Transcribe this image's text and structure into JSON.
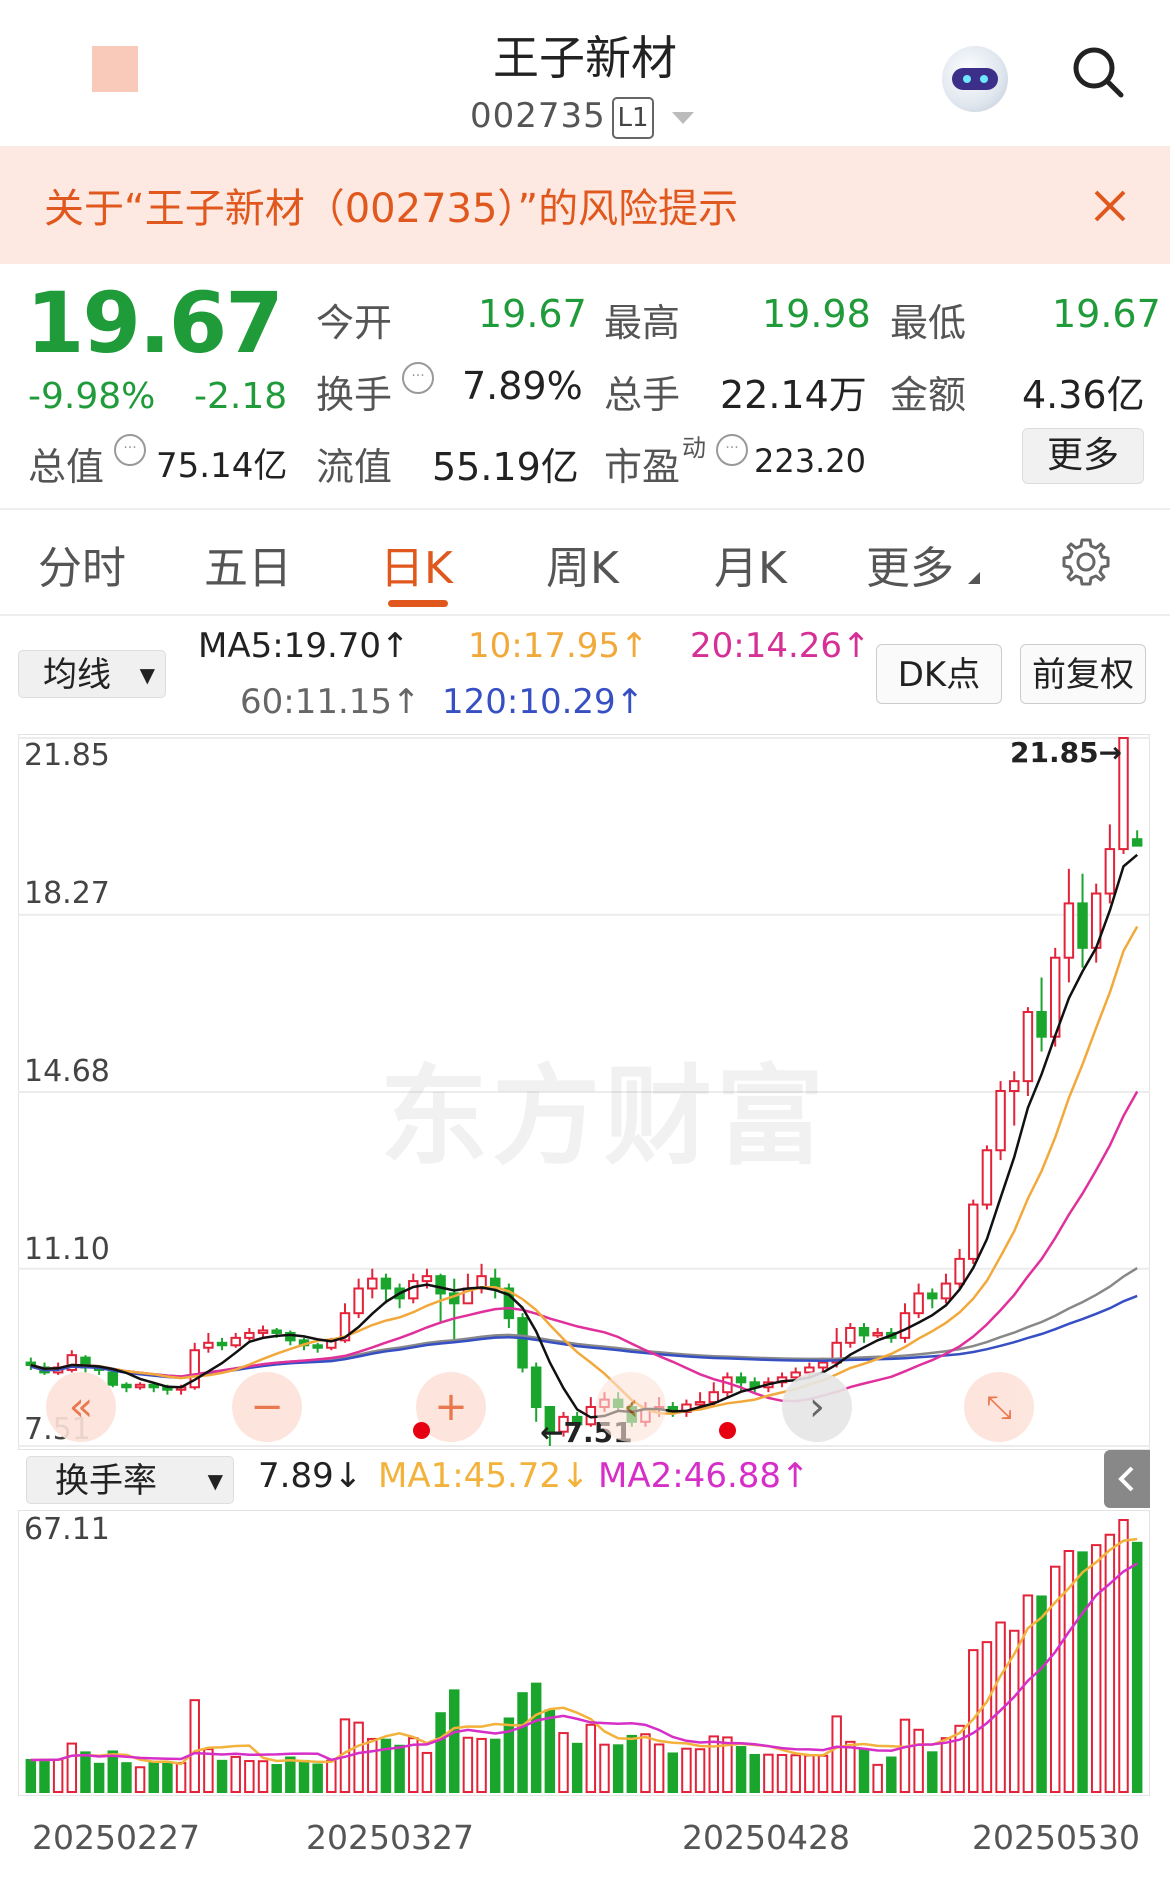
{
  "header": {
    "title": "王子新材",
    "code": "002735",
    "level_badge": "L1"
  },
  "banner": {
    "text": "关于“王子新材（002735）”的风险提示"
  },
  "quote": {
    "price": "19.67",
    "change_pct": "-9.98%",
    "change_amt": "-2.18",
    "fields": {
      "open_label": "今开",
      "open": "19.67",
      "high_label": "最高",
      "high": "19.98",
      "low_label": "最低",
      "low": "19.67",
      "turnover_label": "换手",
      "turnover": "7.89%",
      "volume_label": "总手",
      "volume": "22.14万",
      "amount_label": "金额",
      "amount": "4.36亿",
      "mcap_label": "总值",
      "mcap": "75.14亿",
      "float_label": "流值",
      "float": "55.19亿",
      "pe_label": "市盈",
      "pe_sup": "动",
      "pe": "223.20"
    },
    "more_label": "更多"
  },
  "tabs": [
    "分时",
    "五日",
    "日K",
    "周K",
    "月K",
    "更多"
  ],
  "active_tab": "日K",
  "indicators": {
    "ma_select": "均线",
    "ma5": "MA5:19.70↑",
    "ma10": "10:17.95↑",
    "ma20": "20:14.26↑",
    "ma60": "60:11.15↑",
    "ma120": "120:10.29↑",
    "dk_label": "DK点",
    "adjust_label": "前复权"
  },
  "kline": {
    "y_labels": [
      "21.85",
      "18.27",
      "14.68",
      "11.10",
      "7.51"
    ],
    "max_label": "21.85→",
    "min_label": "←7.51",
    "watermark": "东方财富",
    "colors": {
      "up": "#e2233a",
      "down": "#1aa52d",
      "ma5": "#111111",
      "ma10": "#f2a93b",
      "ma20": "#e0309c",
      "ma60": "#888888",
      "ma120": "#3650c4"
    }
  },
  "volume": {
    "select_label": "换手率",
    "value": "7.89↓",
    "ma1": "MA1:45.72↓",
    "ma2": "MA2:46.88↑",
    "y_label": "67.11"
  },
  "dates": [
    "20250227",
    "20250327",
    "20250428",
    "20250530"
  ],
  "chart_data": {
    "type": "candlestick",
    "ylim": [
      7.51,
      21.85
    ],
    "max": 21.85,
    "min": 7.51,
    "candles": [
      [
        9.2,
        9.15,
        9.3,
        9.05
      ],
      [
        9.1,
        9.0,
        9.2,
        8.95
      ],
      [
        9.0,
        9.1,
        9.2,
        8.95
      ],
      [
        9.05,
        9.35,
        9.45,
        9.0
      ],
      [
        9.3,
        9.1,
        9.35,
        9.0
      ],
      [
        9.1,
        9.05,
        9.15,
        8.95
      ],
      [
        9.0,
        8.75,
        9.05,
        8.7
      ],
      [
        8.75,
        8.7,
        8.8,
        8.6
      ],
      [
        8.7,
        8.75,
        8.8,
        8.65
      ],
      [
        8.75,
        8.7,
        8.8,
        8.6
      ],
      [
        8.7,
        8.65,
        8.75,
        8.55
      ],
      [
        8.65,
        8.7,
        8.75,
        8.55
      ],
      [
        8.7,
        9.45,
        9.6,
        8.65
      ],
      [
        9.5,
        9.6,
        9.8,
        9.4
      ],
      [
        9.6,
        9.55,
        9.7,
        9.45
      ],
      [
        9.55,
        9.7,
        9.8,
        9.5
      ],
      [
        9.7,
        9.8,
        9.9,
        9.65
      ],
      [
        9.8,
        9.85,
        9.95,
        9.7
      ],
      [
        9.85,
        9.8,
        9.9,
        9.7
      ],
      [
        9.8,
        9.65,
        9.85,
        9.55
      ],
      [
        9.65,
        9.55,
        9.7,
        9.45
      ],
      [
        9.55,
        9.5,
        9.6,
        9.4
      ],
      [
        9.5,
        9.65,
        9.7,
        9.45
      ],
      [
        9.65,
        10.2,
        10.4,
        9.6
      ],
      [
        10.2,
        10.7,
        10.9,
        10.1
      ],
      [
        10.7,
        10.9,
        11.1,
        10.5
      ],
      [
        10.9,
        10.7,
        11.0,
        10.4
      ],
      [
        10.7,
        10.5,
        10.8,
        10.3
      ],
      [
        10.5,
        10.85,
        11.0,
        10.4
      ],
      [
        10.85,
        10.95,
        11.1,
        10.7
      ],
      [
        10.95,
        10.6,
        11.0,
        10.0
      ],
      [
        10.6,
        10.4,
        10.9,
        9.6
      ],
      [
        10.4,
        10.7,
        11.0,
        10.4
      ],
      [
        10.7,
        10.95,
        11.2,
        10.6
      ],
      [
        10.9,
        10.7,
        11.1,
        10.5
      ],
      [
        10.7,
        10.1,
        10.8,
        9.9
      ],
      [
        10.1,
        9.1,
        10.2,
        9.0
      ],
      [
        9.1,
        8.3,
        9.2,
        8.0
      ],
      [
        8.3,
        7.8,
        8.3,
        7.51
      ],
      [
        7.8,
        8.1,
        8.2,
        7.7
      ],
      [
        8.1,
        7.95,
        8.2,
        7.8
      ],
      [
        7.95,
        8.3,
        8.5,
        7.9
      ],
      [
        8.3,
        8.45,
        8.6,
        8.2
      ],
      [
        8.45,
        8.3,
        8.6,
        8.2
      ],
      [
        8.3,
        8.0,
        8.4,
        7.9
      ],
      [
        8.0,
        8.25,
        8.4,
        7.9
      ],
      [
        8.25,
        8.3,
        8.5,
        8.1
      ],
      [
        8.3,
        8.2,
        8.4,
        8.1
      ],
      [
        8.2,
        8.35,
        8.45,
        8.1
      ],
      [
        8.35,
        8.4,
        8.6,
        8.25
      ],
      [
        8.4,
        8.6,
        8.8,
        8.3
      ],
      [
        8.6,
        8.9,
        9.0,
        8.5
      ],
      [
        8.9,
        8.8,
        9.0,
        8.6
      ],
      [
        8.8,
        8.7,
        8.9,
        8.6
      ],
      [
        8.7,
        8.8,
        8.9,
        8.6
      ],
      [
        8.8,
        8.9,
        9.0,
        8.7
      ],
      [
        8.9,
        9.0,
        9.1,
        8.8
      ],
      [
        9.0,
        9.1,
        9.2,
        8.9
      ],
      [
        9.1,
        9.2,
        9.3,
        9.0
      ],
      [
        9.2,
        9.6,
        9.9,
        9.1
      ],
      [
        9.6,
        9.9,
        10.0,
        9.5
      ],
      [
        9.9,
        9.75,
        10.0,
        9.6
      ],
      [
        9.75,
        9.8,
        9.9,
        9.7
      ],
      [
        9.8,
        9.7,
        9.9,
        9.6
      ],
      [
        9.7,
        10.2,
        10.4,
        9.6
      ],
      [
        10.2,
        10.6,
        10.8,
        10.1
      ],
      [
        10.6,
        10.5,
        10.7,
        10.3
      ],
      [
        10.5,
        10.8,
        11.0,
        10.4
      ],
      [
        10.8,
        11.3,
        11.5,
        10.7
      ],
      [
        11.3,
        12.4,
        12.5,
        11.2
      ],
      [
        12.4,
        13.5,
        13.6,
        12.3
      ],
      [
        13.5,
        14.7,
        14.9,
        13.3
      ],
      [
        14.7,
        14.9,
        15.1,
        14.0
      ],
      [
        14.9,
        16.3,
        16.4,
        14.6
      ],
      [
        16.3,
        15.8,
        17.0,
        15.5
      ],
      [
        15.8,
        17.4,
        17.6,
        15.6
      ],
      [
        17.4,
        18.5,
        19.2,
        16.9
      ],
      [
        18.5,
        17.6,
        19.1,
        17.2
      ],
      [
        17.6,
        18.7,
        18.9,
        17.3
      ],
      [
        18.7,
        19.6,
        20.1,
        18.5
      ],
      [
        19.6,
        21.85,
        21.85,
        19.5
      ],
      [
        19.8,
        19.67,
        19.98,
        19.67
      ]
    ]
  }
}
